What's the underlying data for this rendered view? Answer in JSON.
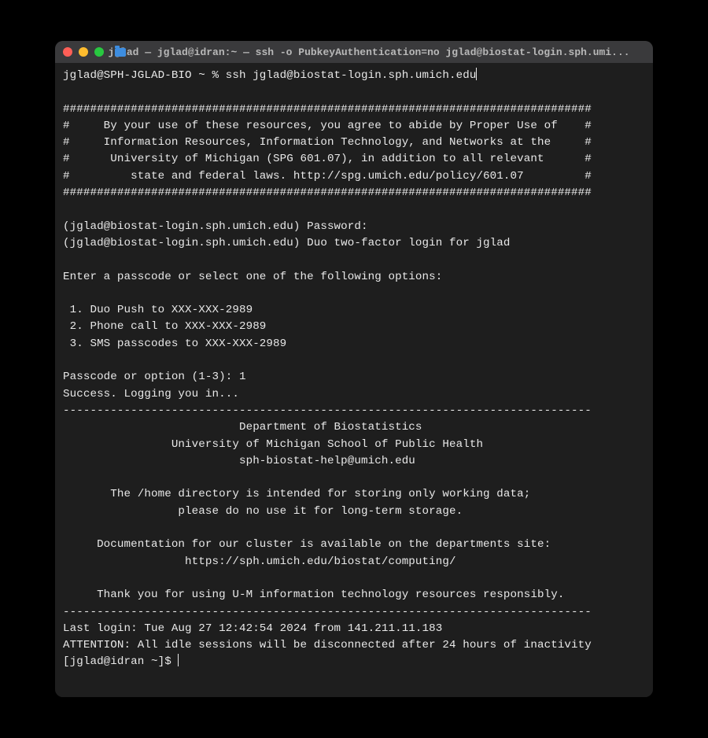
{
  "window": {
    "title": "jglad — jglad@idran:~ — ssh -o PubkeyAuthentication=no jglad@biostat-login.sph.umi..."
  },
  "terminal": {
    "prompt1": "jglad@SPH-JGLAD-BIO ~ % ",
    "command1": "ssh jglad@biostat-login.sph.umich.edu",
    "banner_border": "##############################################################################",
    "banner_l1": "#     By your use of these resources, you agree to abide by Proper Use of    #",
    "banner_l2": "#     Information Resources, Information Technology, and Networks at the     #",
    "banner_l3": "#      University of Michigan (SPG 601.07), in addition to all relevant      #",
    "banner_l4": "#         state and federal laws. http://spg.umich.edu/policy/601.07         #",
    "pw_prompt": "(jglad@biostat-login.sph.umich.edu) Password:",
    "duo_prompt": "(jglad@biostat-login.sph.umich.edu) Duo two-factor login for jglad",
    "options_header": "Enter a passcode or select one of the following options:",
    "opt1": " 1. Duo Push to XXX-XXX-2989",
    "opt2": " 2. Phone call to XXX-XXX-2989",
    "opt3": " 3. SMS passcodes to XXX-XXX-2989",
    "passcode_prompt": "Passcode or option (1-3): ",
    "passcode_choice": "1",
    "success": "Success. Logging you in...",
    "divider": "------------------------------------------------------------------------------",
    "motd_l1": "                          Department of Biostatistics",
    "motd_l2": "                University of Michigan School of Public Health",
    "motd_l3": "                          sph-biostat-help@umich.edu",
    "motd_l5": "       The /home directory is intended for storing only working data;",
    "motd_l6": "                 please do no use it for long-term storage.",
    "motd_l8": "     Documentation for our cluster is available on the departments site:",
    "motd_l9": "                  https://sph.umich.edu/biostat/computing/",
    "motd_l11": "     Thank you for using U-M information technology resources responsibly.",
    "last_login": "Last login: Tue Aug 27 12:42:54 2024 from 141.211.11.183",
    "attention": "ATTENTION: All idle sessions will be disconnected after 24 hours of inactivity",
    "prompt2": "[jglad@idran ~]$ "
  }
}
